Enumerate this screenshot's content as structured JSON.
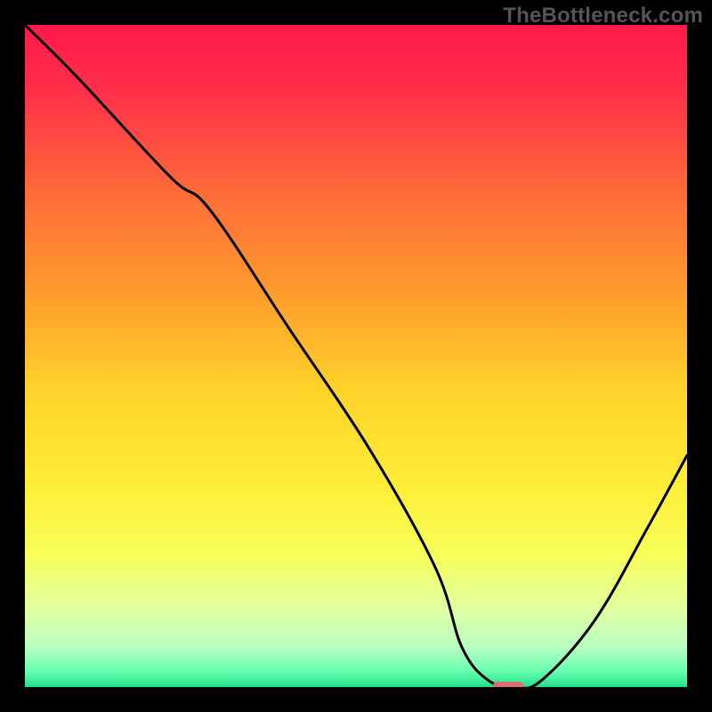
{
  "watermark": "TheBottleneck.com",
  "chart_data": {
    "type": "line",
    "title": "",
    "xlabel": "",
    "ylabel": "",
    "x_range": [
      0,
      100
    ],
    "y_range": [
      0,
      100
    ],
    "gradient_stops": [
      {
        "offset": 0,
        "color": "#ff1a4b"
      },
      {
        "offset": 0.1,
        "color": "#ff2f4a"
      },
      {
        "offset": 0.25,
        "color": "#ff6a3a"
      },
      {
        "offset": 0.4,
        "color": "#ff9a2d"
      },
      {
        "offset": 0.55,
        "color": "#ffd22a"
      },
      {
        "offset": 0.7,
        "color": "#ffee3a"
      },
      {
        "offset": 0.8,
        "color": "#f7ff5a"
      },
      {
        "offset": 0.88,
        "color": "#e2ffa0"
      },
      {
        "offset": 0.94,
        "color": "#b8ffc3"
      },
      {
        "offset": 0.975,
        "color": "#6bffb0"
      },
      {
        "offset": 1.0,
        "color": "#21e08a"
      }
    ],
    "series": [
      {
        "name": "bottleneck-curve",
        "x": [
          0,
          8,
          22,
          28,
          40,
          52,
          62,
          66,
          70,
          74,
          78,
          86,
          94,
          100
        ],
        "y": [
          100,
          92,
          77,
          72,
          54,
          36,
          18,
          6,
          1,
          0,
          1,
          10,
          24,
          35
        ]
      }
    ],
    "marker": {
      "x": 73,
      "y": 0,
      "color": "#d86f6f"
    }
  }
}
